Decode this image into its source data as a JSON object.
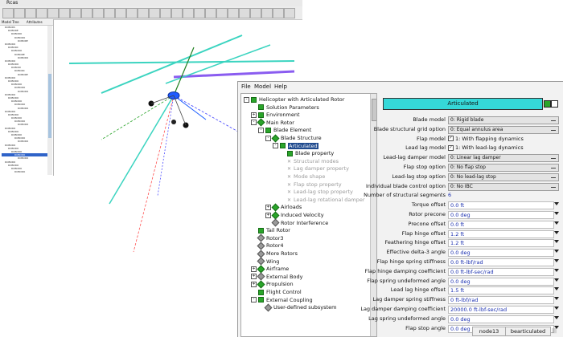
{
  "background_app": {
    "title": "Rcas",
    "toolbar_buttons": [
      "",
      "",
      "",
      "",
      "",
      "",
      "",
      "",
      "",
      "",
      "",
      "",
      "",
      "",
      "",
      "",
      "",
      "",
      "",
      "",
      "",
      "",
      "",
      "",
      "",
      ""
    ],
    "tree_tabs": [
      "Model Tree",
      "Attributes"
    ],
    "tree_lines": [
      "ROBORS",
      "ROBORE",
      "ROBORO",
      "ROBORO",
      "ROBORE",
      "ROBORO",
      "ROBORC",
      "ROBORO",
      "ROBORE",
      "ROBORO",
      "ROBORO",
      "ROBORO",
      "ROBORI",
      "ROBORC",
      "ROBORE",
      "ROBORO",
      "ROBORO",
      "ROBORO",
      "ROBORO",
      "ROBORO",
      "ROBORO",
      "ROBORO",
      "ROBORO",
      "ROBORO",
      "ROBORO",
      "ROBORO",
      "ROBORO",
      "ROBORO",
      "ROBORO",
      "ROBORO",
      "ROBORO",
      "ROBORO",
      "ROBORO",
      "ROBORO",
      "ROBORO",
      "ROBORO",
      "ROBORO",
      "ROBORO",
      "ROBORO",
      "ROBORO",
      "ROBORO",
      "ROBORO",
      "ROBORO",
      "ROBORO"
    ]
  },
  "menubar": {
    "file": "File",
    "model": "Model",
    "help": "Help"
  },
  "tree": [
    {
      "label": "Helicopter with Articulated Rotor",
      "icon": "square",
      "indent": 0,
      "expander": "-"
    },
    {
      "label": "Solution Parameters",
      "icon": "square",
      "indent": 1,
      "expander": ""
    },
    {
      "label": "Environment",
      "icon": "square",
      "indent": 1,
      "expander": "+"
    },
    {
      "label": "Main Rotor",
      "icon": "diamond",
      "indent": 1,
      "expander": "-"
    },
    {
      "label": "Blade Element",
      "icon": "square",
      "indent": 2,
      "expander": "-"
    },
    {
      "label": "Blade Structure",
      "icon": "diamond",
      "indent": 3,
      "expander": "-"
    },
    {
      "label": "Articulated",
      "icon": "square",
      "indent": 4,
      "expander": "-",
      "selected": true
    },
    {
      "label": "Blade property",
      "icon": "square",
      "indent": 5,
      "expander": ""
    },
    {
      "label": "Structural modes",
      "icon": "x",
      "indent": 5,
      "expander": "",
      "dim": true
    },
    {
      "label": "Lag damper property",
      "icon": "x",
      "indent": 5,
      "expander": "",
      "dim": true
    },
    {
      "label": "Mode shape",
      "icon": "x",
      "indent": 5,
      "expander": "",
      "dim": true
    },
    {
      "label": "Flap stop property",
      "icon": "x",
      "indent": 5,
      "expander": "",
      "dim": true
    },
    {
      "label": "Lead-lag stop property",
      "icon": "x",
      "indent": 5,
      "expander": "",
      "dim": true
    },
    {
      "label": "Lead-lag rotational damper",
      "icon": "x",
      "indent": 5,
      "expander": "",
      "dim": true
    },
    {
      "label": "Airloads",
      "icon": "diamond",
      "indent": 3,
      "expander": "+"
    },
    {
      "label": "Induced Velocity",
      "icon": "diamond",
      "indent": 3,
      "expander": "+"
    },
    {
      "label": "Rotor Interference",
      "icon": "diamond-gray",
      "indent": 3,
      "expander": ""
    },
    {
      "label": "Tail Rotor",
      "icon": "square",
      "indent": 1,
      "expander": ""
    },
    {
      "label": "Rotor3",
      "icon": "diamond-gray",
      "indent": 1,
      "expander": ""
    },
    {
      "label": "Rotor4",
      "icon": "diamond-gray",
      "indent": 1,
      "expander": ""
    },
    {
      "label": "More Rotors",
      "icon": "diamond-gray",
      "indent": 1,
      "expander": ""
    },
    {
      "label": "Wing",
      "icon": "diamond-gray",
      "indent": 1,
      "expander": ""
    },
    {
      "label": "Airframe",
      "icon": "diamond",
      "indent": 1,
      "expander": "+"
    },
    {
      "label": "External Body",
      "icon": "diamond-gray",
      "indent": 1,
      "expander": "+"
    },
    {
      "label": "Propulsion",
      "icon": "diamond",
      "indent": 1,
      "expander": "+"
    },
    {
      "label": "Flight Control",
      "icon": "square",
      "indent": 1,
      "expander": ""
    },
    {
      "label": "External Coupling",
      "icon": "square",
      "indent": 1,
      "expander": "-"
    },
    {
      "label": "User-defined subsystem",
      "icon": "diamond-gray",
      "indent": 2,
      "expander": ""
    }
  ],
  "properties": {
    "header": "Articulated",
    "rows": [
      {
        "label": "Blade model",
        "type": "button",
        "value": "0: Rigid blade"
      },
      {
        "label": "Blade structural grid option",
        "type": "button",
        "value": "0: Equal annulus area"
      },
      {
        "label": "Flap model",
        "type": "check",
        "value": "1: With flapping dynamics",
        "mark": "✓"
      },
      {
        "label": "Lead lag model",
        "type": "check",
        "value": "1: With lead-lag dynamics",
        "mark": "✓"
      },
      {
        "label": "Lead-lag damper model",
        "type": "button",
        "value": "0: Linear lag damper"
      },
      {
        "label": "Flap stop option",
        "type": "button",
        "value": "0: No flap stop"
      },
      {
        "label": "Lead-lag stop option",
        "type": "button",
        "value": "0: No lead-lag stop"
      },
      {
        "label": "Individual blade control option",
        "type": "button",
        "value": "0: No IBC"
      },
      {
        "label": "Number of structural segments",
        "type": "plain",
        "value": "6"
      },
      {
        "label": "Torque offset",
        "type": "input",
        "value": "0.0 ft"
      },
      {
        "label": "Rotor precone",
        "type": "input",
        "value": "0.0 deg"
      },
      {
        "label": "Precone offset",
        "type": "input",
        "value": "0.0 ft"
      },
      {
        "label": "Flap hinge offset",
        "type": "input",
        "value": "1.2 ft"
      },
      {
        "label": "Feathering hinge offset",
        "type": "input",
        "value": "1.2 ft"
      },
      {
        "label": "Effective delta-3 angle",
        "type": "input",
        "value": "0.0 deg"
      },
      {
        "label": "Flap hinge spring stiffness",
        "type": "input",
        "value": "0.0 ft-lbf/rad"
      },
      {
        "label": "Flap hinge damping coefficient",
        "type": "input",
        "value": "0.0 ft-lbf-sec/rad"
      },
      {
        "label": "Flap spring undeformed angle",
        "type": "input",
        "value": "0.0 deg"
      },
      {
        "label": "Lead lag hinge offset",
        "type": "input",
        "value": "1.5 ft"
      },
      {
        "label": "Lag damper spring stiffness",
        "type": "input",
        "value": "0 ft-lbf/rad"
      },
      {
        "label": "Lag damper damping coefficient",
        "type": "input",
        "value": "20000.0 ft-lbf-sec/rad"
      },
      {
        "label": "Lag spring undeformed angle",
        "type": "input",
        "value": "0.0 deg"
      },
      {
        "label": "Flap stop angle",
        "type": "input",
        "value": "0.0 deg"
      }
    ]
  },
  "status": {
    "node": "node13",
    "type": "bearticulated",
    "grip": "|||"
  }
}
